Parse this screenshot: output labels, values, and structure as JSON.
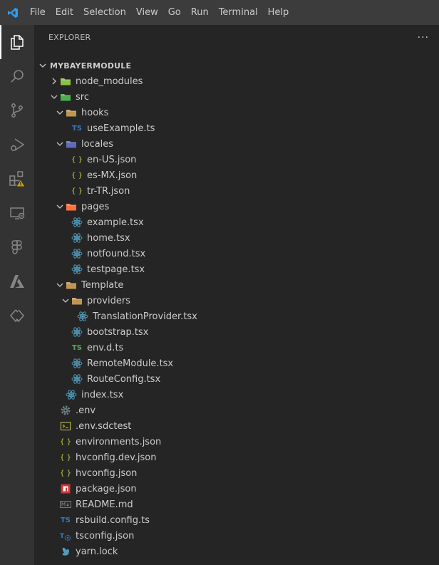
{
  "menubar": {
    "items": [
      "File",
      "Edit",
      "Selection",
      "View",
      "Go",
      "Run",
      "Terminal",
      "Help"
    ],
    "logo_icon": "vscode-logo-icon"
  },
  "activitybar": {
    "items": [
      {
        "icon": "files-icon",
        "active": true
      },
      {
        "icon": "search-icon"
      },
      {
        "icon": "source-control-icon"
      },
      {
        "icon": "run-debug-icon"
      },
      {
        "icon": "extensions-icon",
        "badge": "warning"
      },
      {
        "icon": "remote-explorer-icon"
      },
      {
        "icon": "figma-icon"
      },
      {
        "icon": "azure-icon"
      },
      {
        "icon": "live-share-icon"
      }
    ]
  },
  "sidebar": {
    "title": "EXPLORER",
    "more": "···"
  },
  "tree": [
    {
      "label": "MYBAYERMODULE",
      "depth": 0,
      "type": "root",
      "expanded": true
    },
    {
      "label": "node_modules",
      "depth": 1,
      "type": "folder",
      "expanded": false,
      "color": "#8bc34a"
    },
    {
      "label": "src",
      "depth": 1,
      "type": "folder",
      "expanded": true,
      "color": "#4caf50"
    },
    {
      "label": "hooks",
      "depth": 2,
      "type": "folder",
      "expanded": true,
      "color": "#c09553"
    },
    {
      "label": "useExample.ts",
      "depth": 3,
      "type": "ts"
    },
    {
      "label": "locales",
      "depth": 2,
      "type": "folder",
      "expanded": true,
      "color": "#5c6bc0"
    },
    {
      "label": "en-US.json",
      "depth": 3,
      "type": "json"
    },
    {
      "label": "es-MX.json",
      "depth": 3,
      "type": "json"
    },
    {
      "label": "tr-TR.json",
      "depth": 3,
      "type": "json"
    },
    {
      "label": "pages",
      "depth": 2,
      "type": "folder",
      "expanded": true,
      "color": "#ff7043"
    },
    {
      "label": "example.tsx",
      "depth": 3,
      "type": "react"
    },
    {
      "label": "home.tsx",
      "depth": 3,
      "type": "react"
    },
    {
      "label": "notfound.tsx",
      "depth": 3,
      "type": "react"
    },
    {
      "label": "testpage.tsx",
      "depth": 3,
      "type": "react"
    },
    {
      "label": "Template",
      "depth": 2,
      "type": "folder",
      "expanded": true,
      "color": "#c09553"
    },
    {
      "label": "providers",
      "depth": 3,
      "type": "folder",
      "expanded": true,
      "color": "#c09553"
    },
    {
      "label": "TranslationProvider.tsx",
      "depth": 4,
      "type": "react"
    },
    {
      "label": "bootstrap.tsx",
      "depth": 3,
      "type": "react"
    },
    {
      "label": "env.d.ts",
      "depth": 3,
      "type": "ts",
      "color": "#4caf50"
    },
    {
      "label": "RemoteModule.tsx",
      "depth": 3,
      "type": "react"
    },
    {
      "label": "RouteConfig.tsx",
      "depth": 3,
      "type": "react"
    },
    {
      "label": "index.tsx",
      "depth": 2,
      "type": "react"
    },
    {
      "label": ".env",
      "depth": 1,
      "type": "gear"
    },
    {
      "label": ".env.sdctest",
      "depth": 1,
      "type": "console"
    },
    {
      "label": "environments.json",
      "depth": 1,
      "type": "json"
    },
    {
      "label": "hvconfig.dev.json",
      "depth": 1,
      "type": "json"
    },
    {
      "label": "hvconfig.json",
      "depth": 1,
      "type": "json"
    },
    {
      "label": "package.json",
      "depth": 1,
      "type": "npm"
    },
    {
      "label": "README.md",
      "depth": 1,
      "type": "markdown"
    },
    {
      "label": "rsbuild.config.ts",
      "depth": 1,
      "type": "ts"
    },
    {
      "label": "tsconfig.json",
      "depth": 1,
      "type": "tsconfig"
    },
    {
      "label": "yarn.lock",
      "depth": 1,
      "type": "yarn"
    }
  ]
}
